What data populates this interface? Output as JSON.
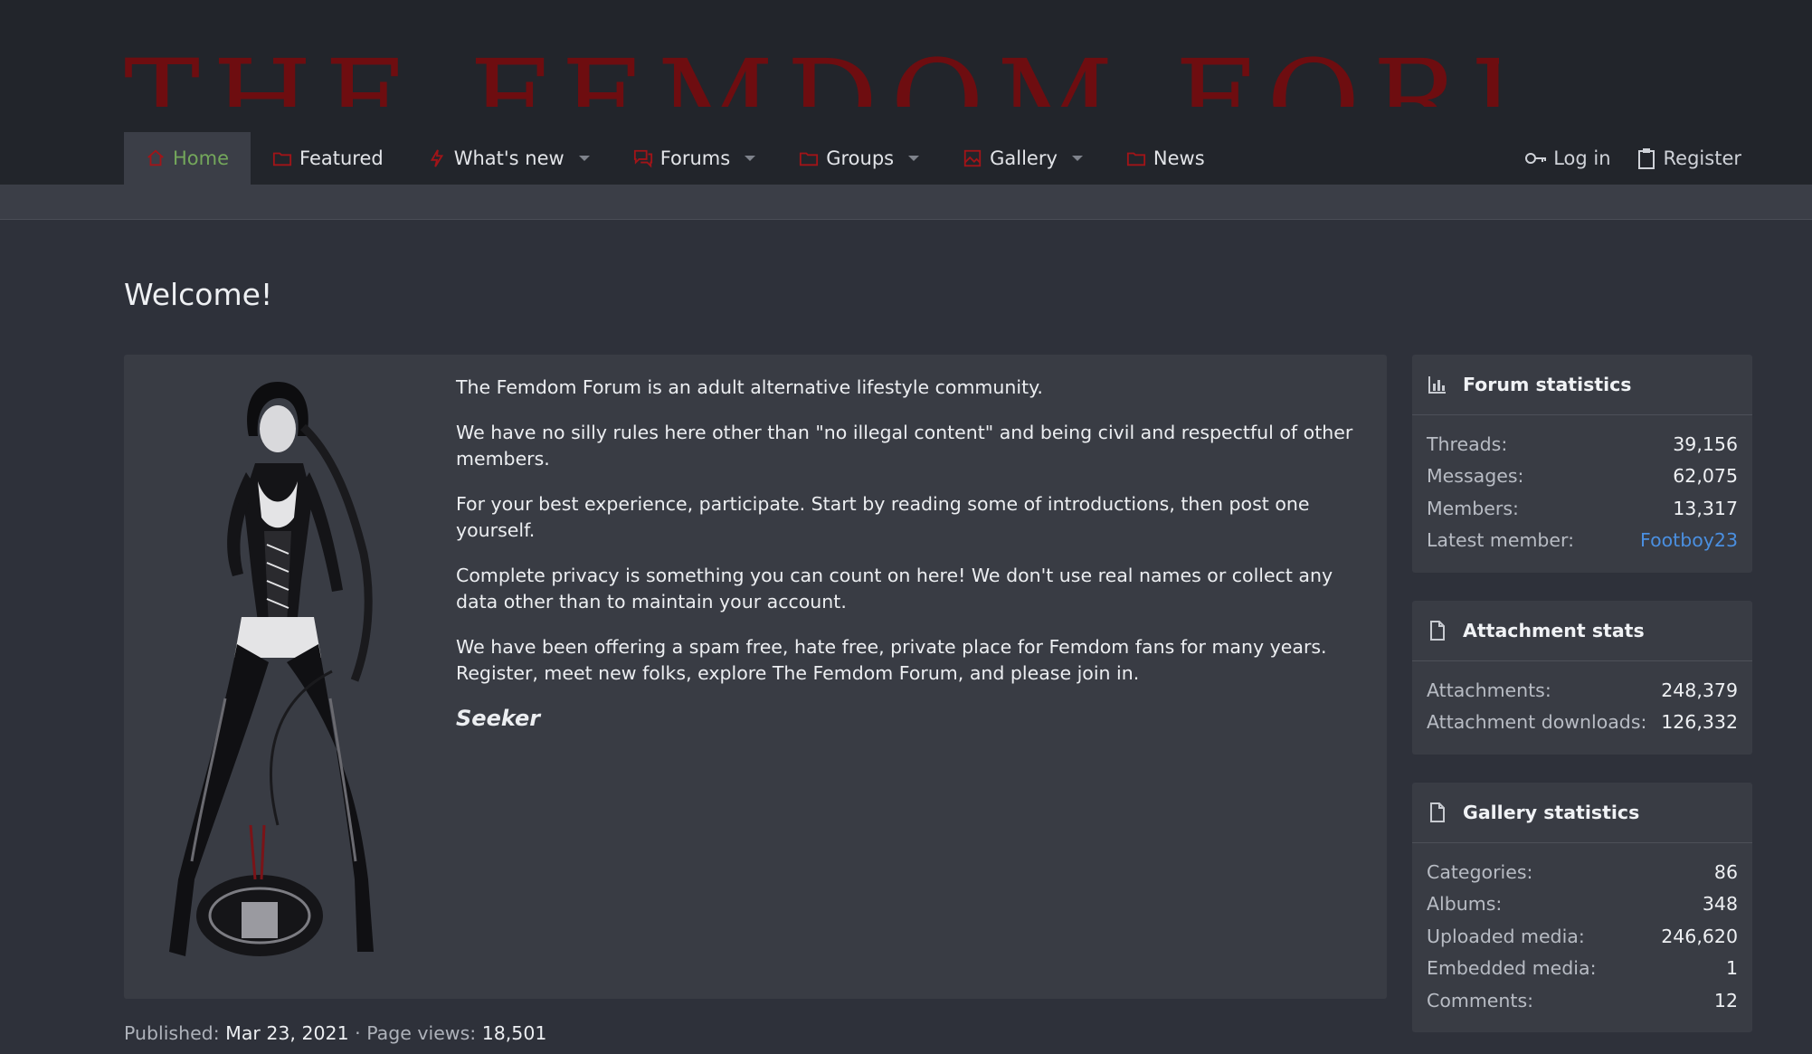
{
  "site": {
    "logo_text": "THE FEMDOM FORUM"
  },
  "nav": {
    "tabs": [
      {
        "label": "Home",
        "icon": "home-icon",
        "active": true,
        "has_menu": false
      },
      {
        "label": "Featured",
        "icon": "folder-icon",
        "active": false,
        "has_menu": false
      },
      {
        "label": "What's new",
        "icon": "bolt-icon",
        "active": false,
        "has_menu": true
      },
      {
        "label": "Forums",
        "icon": "comments-icon",
        "active": false,
        "has_menu": true
      },
      {
        "label": "Groups",
        "icon": "folder-icon",
        "active": false,
        "has_menu": true
      },
      {
        "label": "Gallery",
        "icon": "image-icon",
        "active": false,
        "has_menu": true
      },
      {
        "label": "News",
        "icon": "folder-icon",
        "active": false,
        "has_menu": false
      }
    ],
    "login_label": "Log in",
    "register_label": "Register"
  },
  "page": {
    "title": "Welcome!",
    "paragraphs": [
      "The Femdom Forum is an adult alternative lifestyle community.",
      "We have no silly rules here other than \"no illegal content\" and being civil and respectful of other members.",
      "For your best experience, participate. Start by reading some of introductions, then post one yourself.",
      "Complete privacy is something you can count on here! We don't use real names or collect any data other than to maintain your account.",
      "We have been offering a spam free, hate free, private place for Femdom fans for many years. Register, meet new folks, explore The Femdom Forum, and please join in."
    ],
    "signature": "Seeker",
    "meta": {
      "published_label": "Published:",
      "published_value": "Mar 23, 2021",
      "separator": "·",
      "views_label": "Page views:",
      "views_value": "18,501"
    }
  },
  "sidebar": {
    "forum_stats": {
      "title": "Forum statistics",
      "rows": [
        {
          "label": "Threads:",
          "value": "39,156"
        },
        {
          "label": "Messages:",
          "value": "62,075"
        },
        {
          "label": "Members:",
          "value": "13,317"
        },
        {
          "label": "Latest member:",
          "value": "Footboy23"
        }
      ]
    },
    "attachment_stats": {
      "title": "Attachment stats",
      "rows": [
        {
          "label": "Attachments:",
          "value": "248,379"
        },
        {
          "label": "Attachment downloads:",
          "value": "126,332"
        }
      ]
    },
    "gallery_stats": {
      "title": "Gallery statistics",
      "rows": [
        {
          "label": "Categories:",
          "value": "86"
        },
        {
          "label": "Albums:",
          "value": "348"
        },
        {
          "label": "Uploaded media:",
          "value": "246,620"
        },
        {
          "label": "Embedded media:",
          "value": "1"
        },
        {
          "label": "Comments:",
          "value": "12"
        }
      ]
    }
  },
  "colors": {
    "header_bg": "#22252b",
    "page_bg": "#2e313a",
    "block_bg": "#393c44",
    "logo_red": "#6e0d10",
    "icon_red": "#a11418",
    "active_green": "#74a75b",
    "link_blue": "#4a8fe0"
  }
}
